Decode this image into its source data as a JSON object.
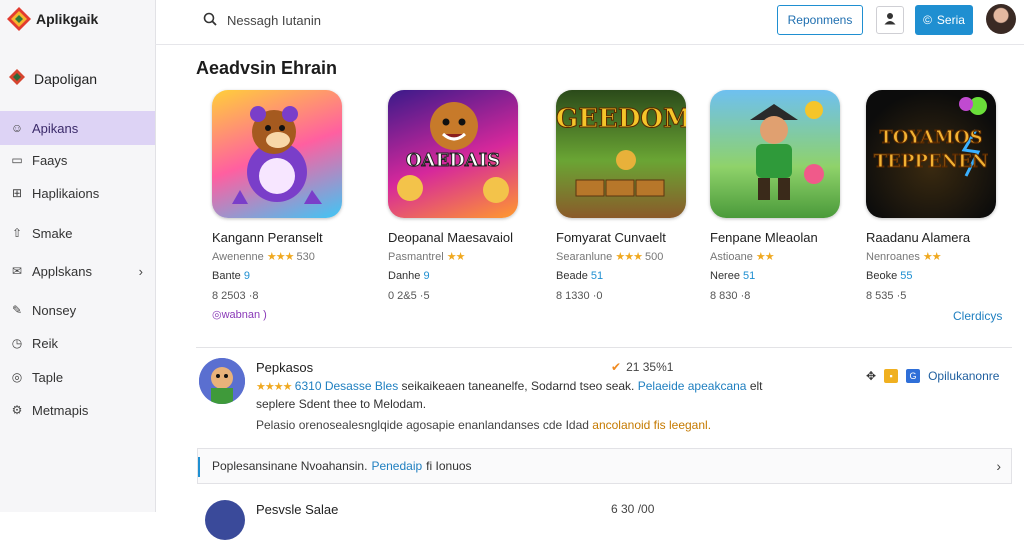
{
  "app": {
    "logo_text": "Aplikgaik"
  },
  "sidebar": {
    "brand": "Dapoligan",
    "items": [
      {
        "label": "Apikans",
        "icon": "smiley-icon",
        "active": true
      },
      {
        "label": "Faays",
        "icon": "chat-icon"
      },
      {
        "label": "Haplikaions",
        "icon": "grid-icon"
      },
      {
        "label": "Smake",
        "icon": "upload-icon"
      },
      {
        "label": "Applskans",
        "icon": "mail-icon",
        "chevron": "›"
      },
      {
        "label": "Nonsey",
        "icon": "pen-icon"
      },
      {
        "label": "Reik",
        "icon": "clock-icon"
      },
      {
        "label": "Taple",
        "icon": "target-icon"
      },
      {
        "label": "Metmapis",
        "icon": "wrench-icon"
      }
    ]
  },
  "header": {
    "search_placeholder": "Nessagh Iutanin",
    "outline_button": "Reponmens",
    "primary_button": "Seria",
    "primary_icon": "©"
  },
  "section": {
    "title": "Aeadvsin Ehrain",
    "more_link": "Clerdicys"
  },
  "cards": [
    {
      "thumb_text": "",
      "title": "Kangann Peranselt",
      "meta": "Awenenne",
      "stars": "★★★",
      "rating": "530",
      "row3_label": "Bante",
      "row3_val": "9",
      "row4": "8 2503 ·8",
      "row5": "◎wabnan )"
    },
    {
      "thumb_text": "OAEDAIS",
      "title": "Deopanal Maesavaiol",
      "meta": "Pasmantrel",
      "stars": "★★",
      "rating": "",
      "row3_label": "Danhe",
      "row3_val": "9",
      "row4": "0 2&5 ·5",
      "row5": ""
    },
    {
      "thumb_text": "GEEDOM",
      "title": "Fomyarat Cunvaelt",
      "meta": "Searanlune",
      "stars": "★★★",
      "rating": "500",
      "row3_label": "Beade",
      "row3_val": "51",
      "row4": "8 1330 ·0",
      "row5": ""
    },
    {
      "thumb_text": "",
      "title": "Fenpane Mleaolan",
      "meta": "Astioane",
      "stars": "★★",
      "rating": "",
      "row3_label": "Neree",
      "row3_val": "51",
      "row4": "8 830 ·8",
      "row5": ""
    },
    {
      "thumb_text": "TOYAMOS TEPPENEN",
      "title": "Raadanu Alamera",
      "meta": "Nenroanes",
      "stars": "★★",
      "rating": "",
      "row3_label": "Beoke",
      "row3_val": "55",
      "row4": "8 535 ·5",
      "row5": ""
    }
  ],
  "list": {
    "title": "Pepkasos",
    "stat": "21 35%1",
    "stars": "★★★★",
    "desc1_a": "6310 Desasse Bles",
    "desc1_b": "seikaikeaen taneanelfe, Sodarnd tseo seak.",
    "desc1_c": "Pelaeide apeakcana",
    "desc1_d": "elt",
    "desc2": "seplere Sdent thee to Melodam.",
    "desc3_a": "Pelasio orenosealesnglqide agosapie enanlandanses cde Idad",
    "desc3_b": "ancolanoid fis leeganl.",
    "action_label": "Opilukanonre"
  },
  "banner": {
    "text_a": "Poplesansinane Nvoahansin.",
    "text_b": "Penedaip",
    "text_c": "fi Ionuos"
  },
  "list2": {
    "title": "Pesvsle Salae",
    "stat": "6 30 /00"
  },
  "colors": {
    "accent": "#1f8fd1",
    "active_nav": "#ddd3f5",
    "stars": "#f0a920"
  }
}
